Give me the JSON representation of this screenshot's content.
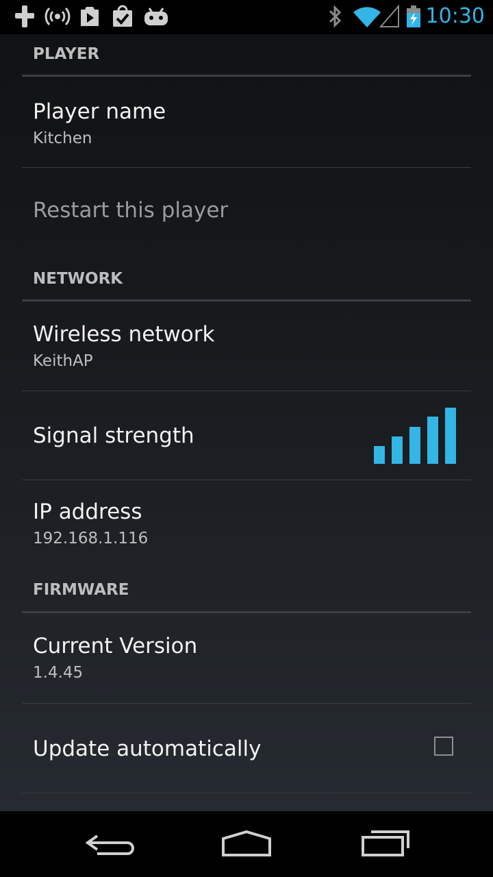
{
  "status_bar": {
    "time": "10:30",
    "icons_left": [
      "plus-icon",
      "broadcast-icon",
      "play-store-icon",
      "bag-icon",
      "android-icon"
    ],
    "icons_right": [
      "bluetooth-icon",
      "wifi-icon",
      "cell-signal-icon",
      "battery-icon"
    ],
    "accent_color": "#33b5e5"
  },
  "sections": {
    "player": {
      "header": "PLAYER",
      "player_name": {
        "title": "Player name",
        "summary": "Kitchen"
      },
      "restart": {
        "title": "Restart this player"
      }
    },
    "network": {
      "header": "NETWORK",
      "wireless": {
        "title": "Wireless network",
        "summary": "KeithAP"
      },
      "signal": {
        "title": "Signal strength",
        "bars_filled": 5,
        "bars_total": 5
      },
      "ip": {
        "title": "IP address",
        "summary": "192.168.1.116"
      }
    },
    "firmware": {
      "header": "FIRMWARE",
      "version": {
        "title": "Current Version",
        "summary": "1.4.45"
      },
      "update": {
        "title": "Update automatically",
        "checked": false
      }
    }
  },
  "nav_bar": {
    "buttons": [
      "back-icon",
      "home-icon",
      "recent-apps-icon"
    ]
  }
}
